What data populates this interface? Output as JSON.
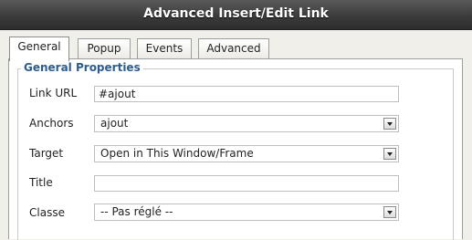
{
  "dialog": {
    "title": "Advanced Insert/Edit Link"
  },
  "tabs": [
    {
      "label": "General",
      "active": true
    },
    {
      "label": "Popup",
      "active": false
    },
    {
      "label": "Events",
      "active": false
    },
    {
      "label": "Advanced",
      "active": false
    }
  ],
  "general": {
    "legend": "General Properties",
    "link_url": {
      "label": "Link URL",
      "value": "#ajout"
    },
    "anchors": {
      "label": "Anchors",
      "value": "ajout"
    },
    "target": {
      "label": "Target",
      "value": "Open in This Window/Frame"
    },
    "title": {
      "label": "Title",
      "value": ""
    },
    "classe": {
      "label": "Classe",
      "value": "-- Pas réglé --"
    }
  },
  "icons": {
    "dropdown": "chevron-down-icon"
  }
}
